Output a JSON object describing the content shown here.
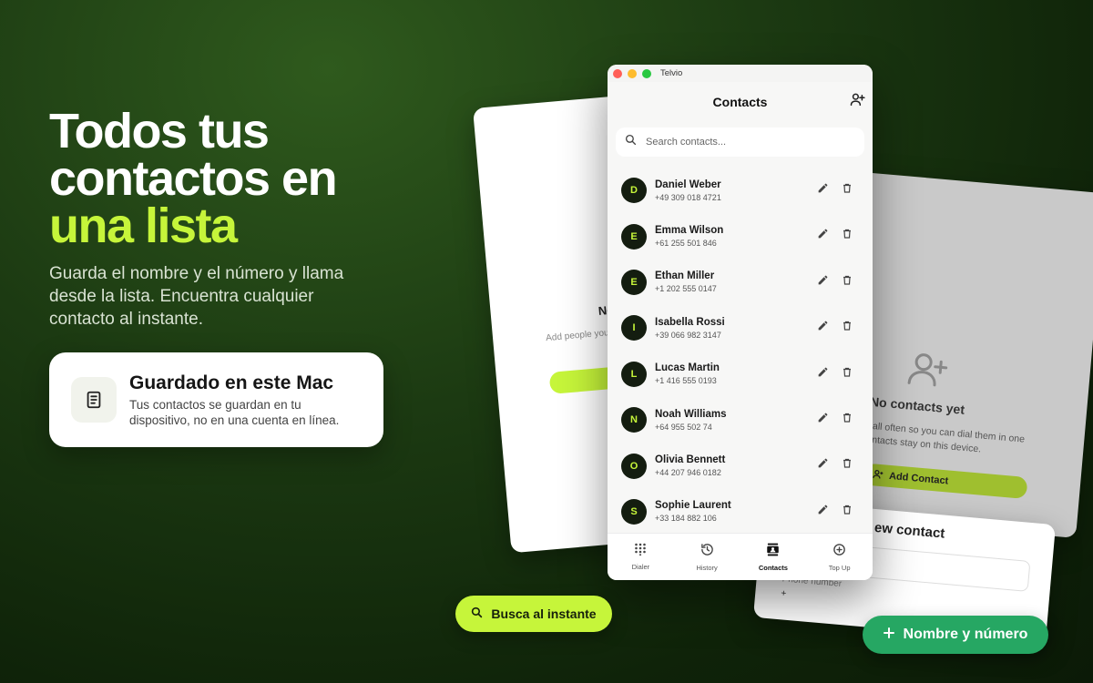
{
  "hero": {
    "title_line1": "Todos tus",
    "title_line2": "contactos en",
    "title_line3": "una lista",
    "subtitle": "Guarda el nombre y el número y llama desde la lista. Encuentra cualquier contacto al instante."
  },
  "info_card": {
    "icon": "document-icon",
    "title": "Guardado en este Mac",
    "text": "Tus contactos se guardan en tu dispositivo, no en una cuenta en línea."
  },
  "back_left": {
    "title": "No",
    "subtitle": "Add people you c... tap. Co..."
  },
  "back_right": {
    "icon": "add-person-icon",
    "title": "No contacts yet",
    "subtitle": "call often so you can dial them in one ontacts stay on this device.",
    "button": "Add Contact"
  },
  "new_contact": {
    "title": "ew contact",
    "phone_label": "Phone number",
    "plus": "+"
  },
  "window": {
    "app_name": "Telvio",
    "header": "Contacts",
    "search_placeholder": "Search contacts...",
    "contacts": [
      {
        "initial": "D",
        "name": "Daniel Weber",
        "phone": "+49 309 018 4721"
      },
      {
        "initial": "E",
        "name": "Emma Wilson",
        "phone": "+61 255 501 846"
      },
      {
        "initial": "E",
        "name": "Ethan Miller",
        "phone": "+1 202 555 0147"
      },
      {
        "initial": "I",
        "name": "Isabella Rossi",
        "phone": "+39 066 982 3147"
      },
      {
        "initial": "L",
        "name": "Lucas Martin",
        "phone": "+1 416 555 0193"
      },
      {
        "initial": "N",
        "name": "Noah Williams",
        "phone": "+64 955 502 74"
      },
      {
        "initial": "O",
        "name": "Olivia Bennett",
        "phone": "+44 207 946 0182"
      },
      {
        "initial": "S",
        "name": "Sophie Laurent",
        "phone": "+33 184 882 106"
      }
    ],
    "tabs": [
      {
        "label": "Dialer",
        "icon": "keypad-icon"
      },
      {
        "label": "History",
        "icon": "history-icon"
      },
      {
        "label": "Contacts",
        "icon": "contacts-icon"
      },
      {
        "label": "Top Up",
        "icon": "plus-circle-icon"
      }
    ],
    "active_tab": "Contacts"
  },
  "pills": {
    "search": "Busca al instante",
    "name_number": "Nombre y número"
  },
  "colors": {
    "accent": "#c6f53a",
    "green_button": "#26a763",
    "background": "#1c3a12"
  }
}
